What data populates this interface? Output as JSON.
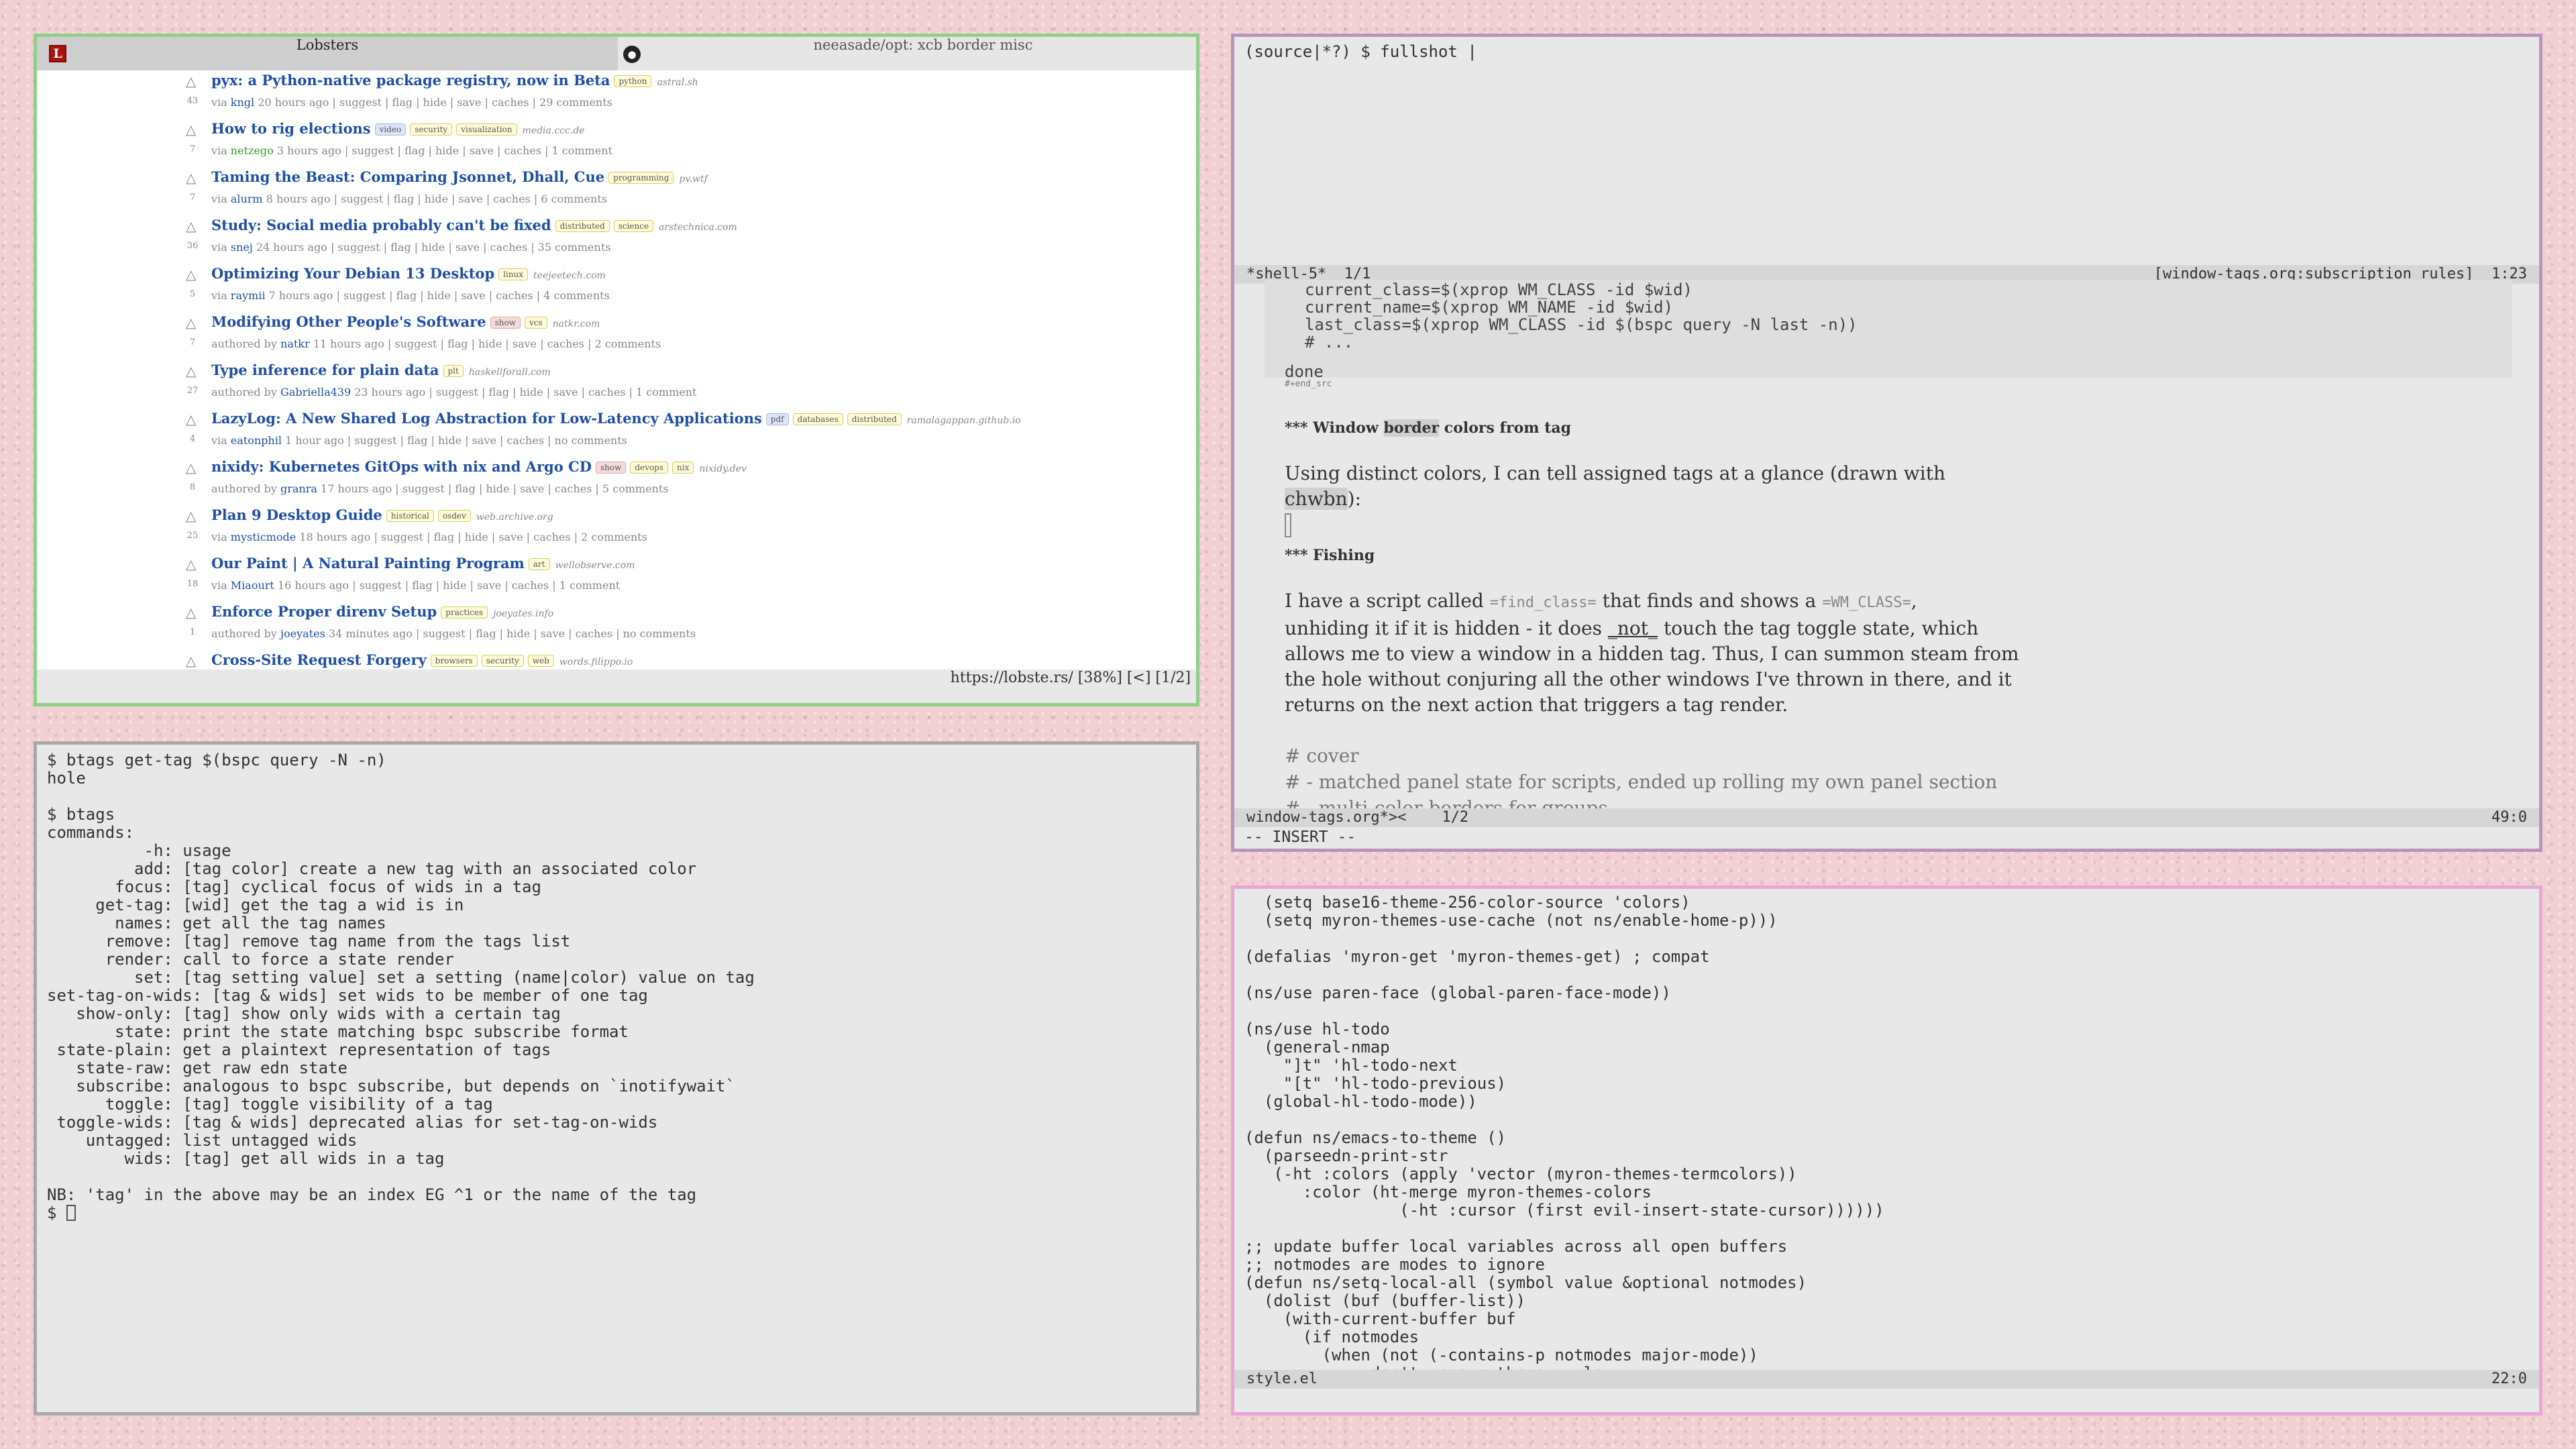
{
  "browser": {
    "tab_logo": "L",
    "tab_title": "Lobsters",
    "tab2_title": "neeasade/opt: xcb border misc",
    "status_url": "https://lobste.rs/ [38%] [<] [1/2]",
    "stories": [
      {
        "score": "43",
        "title": "pyx: a Python-native package registry, now in Beta",
        "tags": [
          {
            "t": "python",
            "k": ""
          }
        ],
        "domain": "astral.sh",
        "pre": "via",
        "user": "kngl",
        "user_new": false,
        "meta": "20 hours ago | suggest | flag | hide | save | caches | 29 comments"
      },
      {
        "score": "7",
        "title": "How to rig elections",
        "tags": [
          {
            "t": "video",
            "k": "media"
          },
          {
            "t": "security",
            "k": ""
          },
          {
            "t": "visualization",
            "k": ""
          }
        ],
        "domain": "media.ccc.de",
        "pre": "via",
        "user": "netzego",
        "user_new": true,
        "meta": "3 hours ago | suggest | flag | hide | save | caches | 1 comment"
      },
      {
        "score": "7",
        "title": "Taming the Beast: Comparing Jsonnet, Dhall, Cue",
        "tags": [
          {
            "t": "programming",
            "k": ""
          }
        ],
        "domain": "pv.wtf",
        "pre": "via",
        "user": "alurm",
        "user_new": false,
        "meta": "8 hours ago | suggest | flag | hide | save | caches | 6 comments"
      },
      {
        "score": "36",
        "title": "Study: Social media probably can't be fixed",
        "tags": [
          {
            "t": "distributed",
            "k": ""
          },
          {
            "t": "science",
            "k": ""
          }
        ],
        "domain": "arstechnica.com",
        "pre": "via",
        "user": "snej",
        "user_new": false,
        "meta": "24 hours ago | suggest | flag | hide | save | caches | 35 comments"
      },
      {
        "score": "5",
        "title": "Optimizing Your Debian 13 Desktop",
        "tags": [
          {
            "t": "linux",
            "k": ""
          }
        ],
        "domain": "teejeetech.com",
        "pre": "via",
        "user": "raymii",
        "user_new": false,
        "meta": "7 hours ago | suggest | flag | hide | save | caches | 4 comments"
      },
      {
        "score": "7",
        "title": "Modifying Other People's Software",
        "tags": [
          {
            "t": "show",
            "k": "meta"
          },
          {
            "t": "vcs",
            "k": ""
          }
        ],
        "domain": "natkr.com",
        "pre": "authored by",
        "user": "natkr",
        "user_new": false,
        "meta": "11 hours ago | suggest | flag | hide | save | caches | 2 comments"
      },
      {
        "score": "27",
        "title": "Type inference for plain data",
        "tags": [
          {
            "t": "plt",
            "k": ""
          }
        ],
        "domain": "haskellforall.com",
        "pre": "authored by",
        "user": "Gabriella439",
        "user_new": false,
        "meta": "23 hours ago | suggest | flag | hide | save | caches | 1 comment"
      },
      {
        "score": "4",
        "title": "LazyLog: A New Shared Log Abstraction for Low-Latency Applications",
        "tags": [
          {
            "t": "pdf",
            "k": "media"
          },
          {
            "t": "databases",
            "k": ""
          },
          {
            "t": "distributed",
            "k": ""
          }
        ],
        "domain": "ramalagappan.github.io",
        "pre": "via",
        "user": "eatonphil",
        "user_new": false,
        "meta": "1 hour ago | suggest | flag | hide | save | caches | no comments"
      },
      {
        "score": "8",
        "title": "nixidy: Kubernetes GitOps with nix and Argo CD",
        "tags": [
          {
            "t": "show",
            "k": "meta"
          },
          {
            "t": "devops",
            "k": ""
          },
          {
            "t": "nix",
            "k": ""
          }
        ],
        "domain": "nixidy.dev",
        "pre": "authored by",
        "user": "granra",
        "user_new": false,
        "meta": "17 hours ago | suggest | flag | hide | save | caches | 5 comments"
      },
      {
        "score": "25",
        "title": "Plan 9 Desktop Guide",
        "tags": [
          {
            "t": "historical",
            "k": ""
          },
          {
            "t": "osdev",
            "k": ""
          }
        ],
        "domain": "web.archive.org",
        "pre": "via",
        "user": "mysticmode",
        "user_new": false,
        "meta": "18 hours ago | suggest | flag | hide | save | caches | 2 comments"
      },
      {
        "score": "18",
        "title": "Our Paint | A Natural Painting Program",
        "tags": [
          {
            "t": "art",
            "k": ""
          }
        ],
        "domain": "wellobserve.com",
        "pre": "via",
        "user": "Miaourt",
        "user_new": false,
        "meta": "16 hours ago | suggest | flag | hide | save | caches | 1 comment"
      },
      {
        "score": "1",
        "title": "Enforce Proper direnv Setup",
        "tags": [
          {
            "t": "practices",
            "k": ""
          }
        ],
        "domain": "joeyates.info",
        "pre": "authored by",
        "user": "joeyates",
        "user_new": false,
        "meta": "34 minutes ago | suggest | flag | hide | save | caches | no comments"
      },
      {
        "score": "",
        "title": "Cross-Site Request Forgery",
        "tags": [
          {
            "t": "browsers",
            "k": ""
          },
          {
            "t": "security",
            "k": ""
          },
          {
            "t": "web",
            "k": ""
          }
        ],
        "domain": "words.filippo.io",
        "pre": "",
        "user": "",
        "user_new": false,
        "meta": ""
      }
    ]
  },
  "terminal": {
    "text": "$ btags get-tag $(bspc query -N -n)\nhole\n\n$ btags\ncommands:\n          -h: usage\n         add: [tag color] create a new tag with an associated color\n       focus: [tag] cyclical focus of wids in a tag\n     get-tag: [wid] get the tag a wid is in\n       names: get all the tag names\n      remove: [tag] remove tag name from the tags list\n      render: call to force a state render\n         set: [tag setting value] set a setting (name|color) value on tag\nset-tag-on-wids: [tag & wids] set wids to be member of one tag\n   show-only: [tag] show only wids with a certain tag\n       state: print the state matching bspc subscribe format\n state-plain: get a plaintext representation of tags\n   state-raw: get raw edn state\n   subscribe: analogous to bspc subscribe, but depends on `inotifywait`\n      toggle: [tag] toggle visibility of a tag\n toggle-wids: [tag & wids] deprecated alias for set-tag-on-wids\n    untagged: list untagged wids\n        wids: [tag] get all wids in a tag\n\nNB: 'tag' in the above may be an index EG ^1 or the name of the tag\n",
    "prompt": "$ "
  },
  "emacs_top": {
    "shell_prompt": "(source|*?) $ fullshot |",
    "modeline1_left": "*shell-5*  1/1",
    "modeline1_right": "[window-tags.org:subscription_rules]  1:23",
    "code_lines": "current_class=$(xprop WM_CLASS -id $wid)\ncurrent_name=$(xprop WM_NAME -id $wid)\nlast_class=$(xprop WM_CLASS -id $(bspc query -N last -n))\n# ...",
    "done": "done",
    "end_src": "#+end_src",
    "heading1_pre": "*** Window ",
    "heading1_hl": "border",
    "heading1_post": " colors from tag",
    "para1_pre": "Using distinct colors, I can tell assigned tags at a glance (drawn with ",
    "para1_code": "chwbn",
    "para1_post": "):",
    "heading2": "*** Fishing",
    "para2_a": "I have a script called ",
    "para2_code1": "=find_class=",
    "para2_b": " that finds and shows a ",
    "para2_code2": "=WM_CLASS=",
    "para2_c": ",",
    "para2_d": "unhiding it if it is hidden - it does ",
    "para2_em": "_not_",
    "para2_e": " touch the tag toggle state, which allows me to view a window in a hidden tag. Thus, I can summon steam from the hole without conjuring all the other windows I've thrown in there, and it returns on the next action that triggers a tag render.",
    "comment1": "# cover",
    "comment2": "# - matched panel state for scripts, ended up rolling my own panel section",
    "comment3": "# - multi-color borders for groups",
    "modeline2_left": "window-tags.org*><    1/2",
    "modeline2_right": "49:0",
    "minibuffer": "-- INSERT --"
  },
  "emacs_bottom": {
    "code": "  (setq base16-theme-256-color-source 'colors)\n  (setq myron-themes-use-cache (not ns/enable-home-p)))\n\n(defalias 'myron-get 'myron-themes-get) ; compat\n\n(ns/use paren-face (global-paren-face-mode))\n\n(ns/use hl-todo\n  (general-nmap\n    \"]t\" 'hl-todo-next\n    \"[t\" 'hl-todo-previous)\n  (global-hl-todo-mode))\n\n(defun ns/emacs-to-theme ()\n  (parseedn-print-str\n   (-ht :colors (apply 'vector (myron-themes-termcolors))\n      :color (ht-merge myron-themes-colors\n                (-ht :cursor (first evil-insert-state-cursor))))))\n\n;; update buffer local variables across all open buffers\n;; notmodes are modes to ignore\n(defun ns/setq-local-all (symbol value &optional notmodes)\n  (dolist (buf (buffer-list))\n    (with-current-buffer buf\n      (if notmodes\n        (when (not (-contains-p notmodes major-mode))\n          ;; don't remove these evals",
    "modeline_left": "style.el",
    "modeline_right": "22:0"
  },
  "colors": {
    "desktop": "#f1cfd3",
    "browser_border": "#8fd088",
    "terminal_border": "#a8a8a8",
    "emacs_top_border": "#b996b8",
    "emacs_bottom_border": "#e8a6d6",
    "link": "#1e4fa8"
  }
}
